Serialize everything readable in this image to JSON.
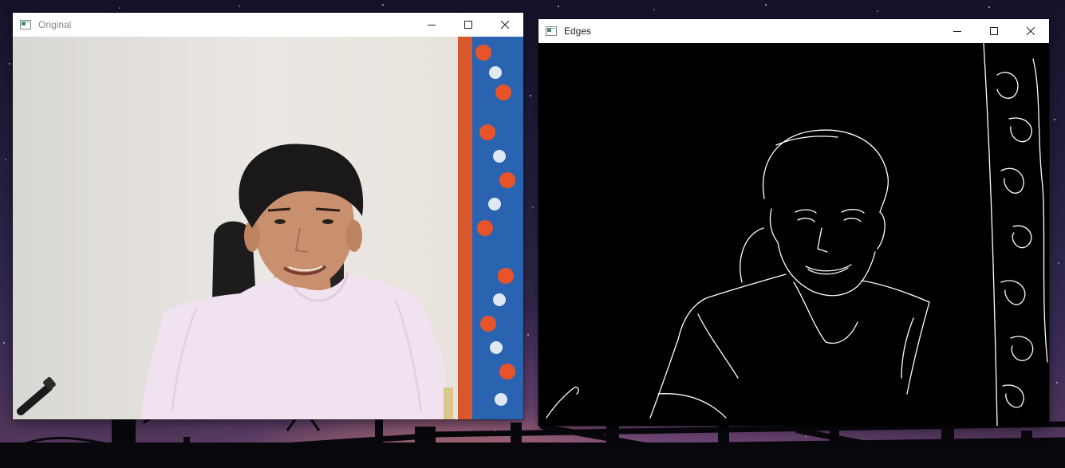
{
  "desktop": {
    "windows": [
      {
        "id": "original",
        "title": "Original"
      },
      {
        "id": "edges",
        "title": "Edges"
      }
    ]
  },
  "colors": {
    "titlebar": "#ffffff",
    "title_text": "#8a8a8a",
    "edges_background": "#000000",
    "edge_lines": "#ffffff",
    "wall": "#e9e6e1",
    "shirt": "#f1e2ef"
  },
  "icons": [
    "app-icon",
    "minimize-icon",
    "maximize-icon",
    "close-icon"
  ]
}
